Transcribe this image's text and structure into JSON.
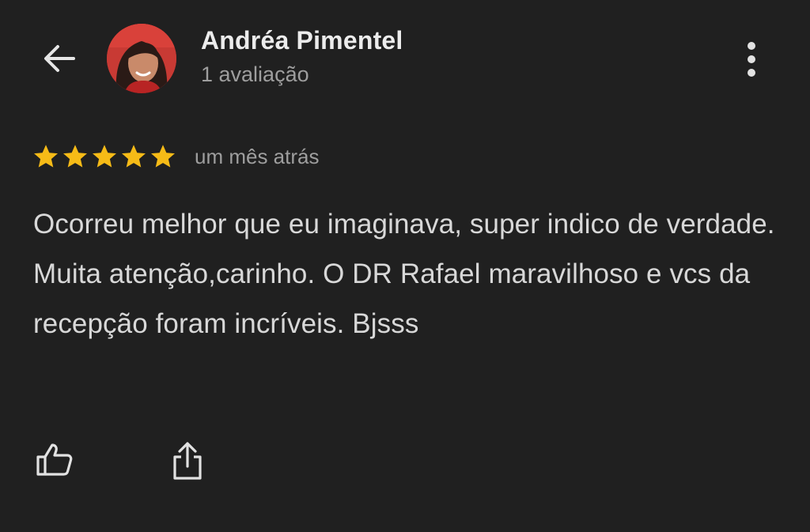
{
  "reviewer": {
    "name": "Andréa Pimentel",
    "review_count": "1 avaliação"
  },
  "review": {
    "stars": 5,
    "max_stars": 5,
    "date": "um mês atrás",
    "text": "Ocorreu melhor que eu imaginava, super indico de verdade. Muita atenção,carinho. O DR Rafael maravilhoso e vcs da recepção foram incríveis. Bjsss"
  },
  "icons": {
    "back": "arrow-left-icon",
    "more": "more-vertical-icon",
    "like": "thumbs-up-icon",
    "share": "share-icon",
    "star": "star-icon"
  },
  "colors": {
    "background": "#202020",
    "star": "#f6bb17",
    "text_primary": "#ececec",
    "text_secondary": "#9e9e9e"
  }
}
